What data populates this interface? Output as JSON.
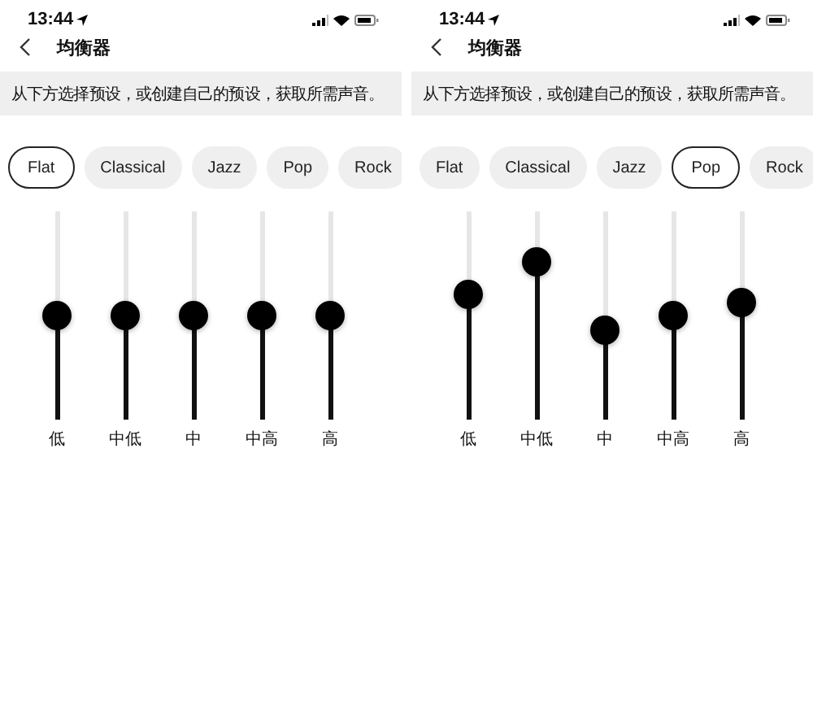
{
  "screens": [
    {
      "status_bar": {
        "time": "13:44"
      },
      "title": "均衡器",
      "hint": "从下方选择预设，或创建自己的预设，获取所需声音。",
      "presets": [
        {
          "label": "Flat",
          "selected": true
        },
        {
          "label": "Classical",
          "selected": false
        },
        {
          "label": "Jazz",
          "selected": false
        },
        {
          "label": "Pop",
          "selected": false
        },
        {
          "label": "Rock",
          "selected": false
        }
      ],
      "bands": [
        {
          "label": "低",
          "level": 0.5
        },
        {
          "label": "中低",
          "level": 0.5
        },
        {
          "label": "中",
          "level": 0.5
        },
        {
          "label": "中高",
          "level": 0.5
        },
        {
          "label": "高",
          "level": 0.5
        }
      ]
    },
    {
      "status_bar": {
        "time": "13:44"
      },
      "title": "均衡器",
      "hint": "从下方选择预设，或创建自己的预设，获取所需声音。",
      "presets": [
        {
          "label": "Flat",
          "selected": false
        },
        {
          "label": "Classical",
          "selected": false
        },
        {
          "label": "Jazz",
          "selected": false
        },
        {
          "label": "Pop",
          "selected": true
        },
        {
          "label": "Rock",
          "selected": false
        }
      ],
      "bands": [
        {
          "label": "低",
          "level": 0.6
        },
        {
          "label": "中低",
          "level": 0.76
        },
        {
          "label": "中",
          "level": 0.43
        },
        {
          "label": "中高",
          "level": 0.5
        },
        {
          "label": "高",
          "level": 0.56
        }
      ]
    }
  ]
}
